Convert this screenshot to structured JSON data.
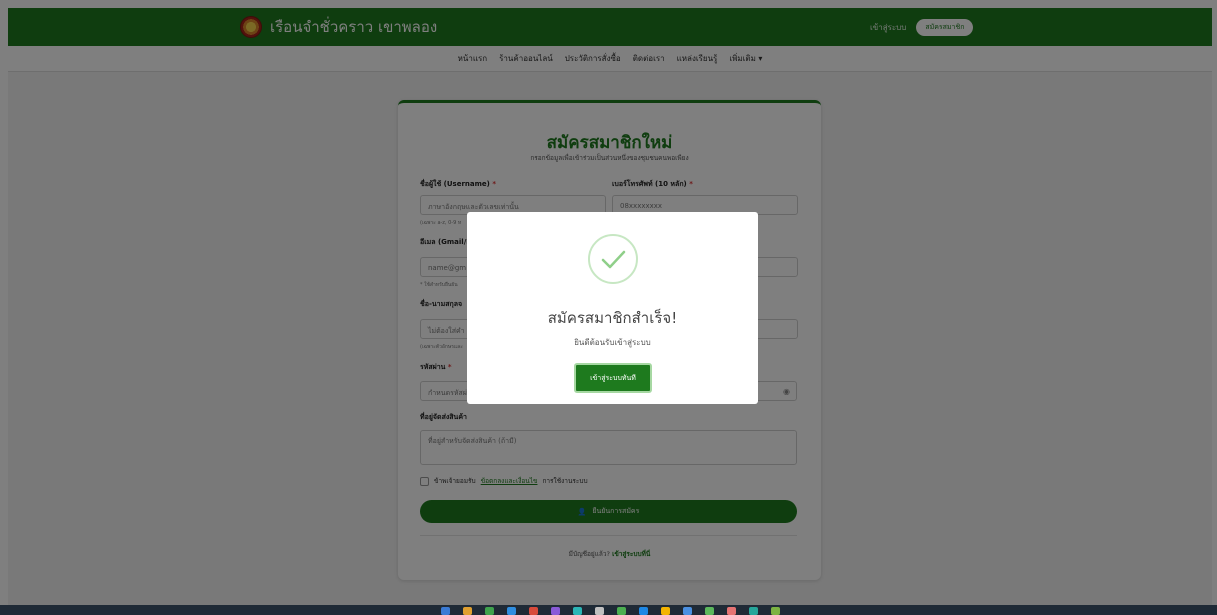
{
  "header": {
    "brand": "เรือนจำชั่วคราว เขาพลอง",
    "login": "เข้าสู่ระบบ",
    "register": "สมัครสมาชิก"
  },
  "nav": {
    "items": [
      {
        "label": "หน้าแรก"
      },
      {
        "label": "ร้านค้าออนไลน์"
      },
      {
        "label": "ประวัติการสั่งซื้อ"
      },
      {
        "label": "ติดต่อเรา"
      },
      {
        "label": "แหล่งเรียนรู้"
      },
      {
        "label": "เพิ่มเติม ▾"
      }
    ]
  },
  "form": {
    "title": "สมัครสมาชิกใหม่",
    "subtitle": "กรอกข้อมูลเพื่อเข้าร่วมเป็นส่วนหนึ่งของชุมชนคนพอเพียง",
    "username_label": "ชื่อผู้ใช้ (Username)",
    "username_placeholder": "ภาษาอังกฤษและตัวเลขเท่านั้น",
    "username_hint": "(เฉพาะ a-z, 0-9 ห",
    "phone_label": "เบอร์โทรศัพท์ (10 หลัก)",
    "phone_placeholder": "08xxxxxxxx",
    "email_label": "อีเมล (Gmail/H",
    "email_placeholder": "name@gm",
    "email_hint": "* ใช้สำหรับยืนยัน",
    "fullname_label": "ชื่อ-นามสกุลจ",
    "fullname_placeholder": "ไม่ต้องใส่คำ",
    "fullname_hint": "(เฉพาะตัวอักษรและ",
    "password_label": "รหัสผ่าน",
    "password_placeholder": "กำหนดรหัสผ่",
    "address_label": "ที่อยู่จัดส่งสินค้า",
    "address_placeholder": "ที่อยู่สำหรับจัดส่งสินค้า (ถ้ามี)",
    "terms_prefix": "ข้าพเจ้ายอมรับ",
    "terms_link": "ข้อตกลงและเงื่อนไข",
    "terms_suffix": "การใช้งานระบบ",
    "submit": "ยืนยันการสมัคร",
    "have_account": "มีบัญชีอยู่แล้ว?",
    "login_here": "เข้าสู่ระบบที่นี่",
    "required_mark": "*"
  },
  "modal": {
    "title": "สมัครสมาชิกสำเร็จ!",
    "message": "ยินดีต้อนรับเข้าสู่ระบบ",
    "button": "เข้าสู่ระบบทันที"
  },
  "colors": {
    "brand_green": "#1e7a1e",
    "success_ring": "#c7e7c3",
    "success_check": "#8fcf89"
  }
}
